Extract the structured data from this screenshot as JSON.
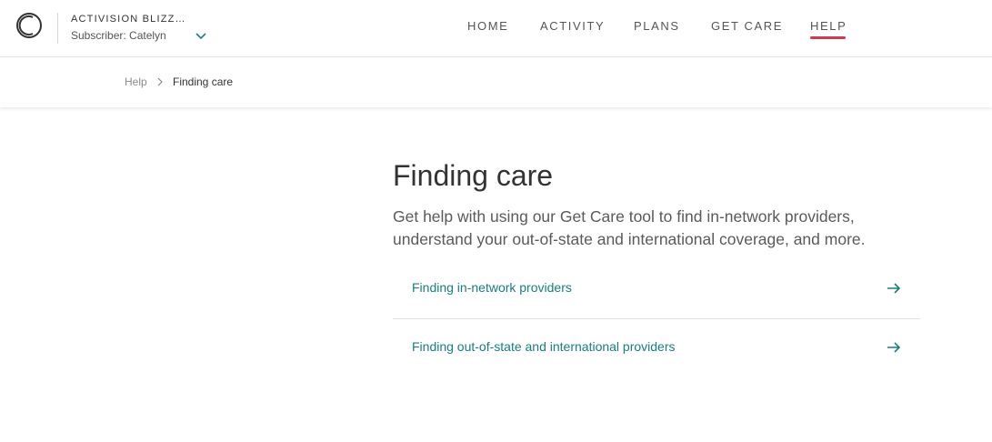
{
  "header": {
    "org_name": "ACTIVISION BLIZZ…",
    "subscriber": "Subscriber: Catelyn",
    "nav": [
      {
        "label": "HOME"
      },
      {
        "label": "ACTIVITY"
      },
      {
        "label": "PLANS"
      },
      {
        "label": "GET CARE"
      },
      {
        "label": "HELP",
        "active": true
      }
    ],
    "active_color": "#cf3a4e"
  },
  "breadcrumb": {
    "parent": "Help",
    "current": "Finding care"
  },
  "main": {
    "title": "Finding care",
    "subtitle": "Get help with using our Get Care tool to find in-network providers, understand your out-of-state and international coverage, and more.",
    "links": [
      {
        "label": "Finding in-network providers"
      },
      {
        "label": "Finding out-of-state and international providers"
      }
    ],
    "link_color": "#1a7d82"
  }
}
